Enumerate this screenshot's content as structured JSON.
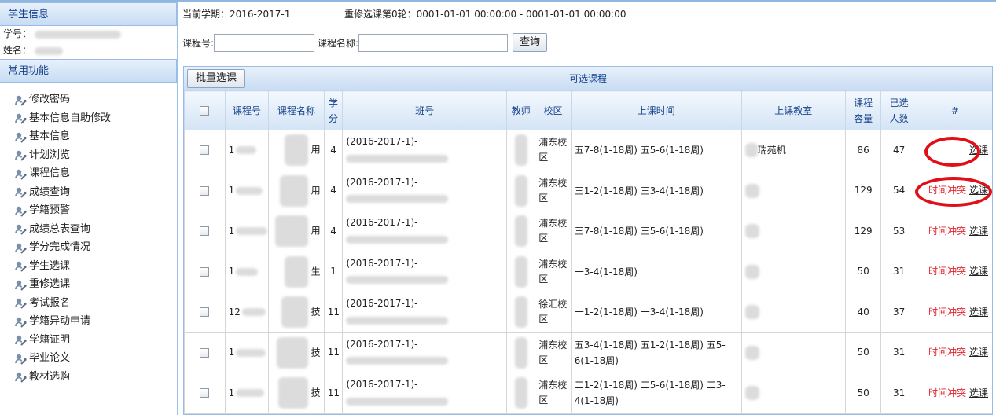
{
  "sidebar": {
    "student_title": "学生信息",
    "id_label": "学号：",
    "name_label": "姓名：",
    "functions_title": "常用功能",
    "menu": [
      "修改密码",
      "基本信息自助修改",
      "基本信息",
      "计划浏览",
      "课程信息",
      "成绩查询",
      "学籍预警",
      "成绩总表查询",
      "学分完成情况",
      "学生选课",
      "重修选课",
      "考试报名",
      "学籍异动申请",
      "学籍证明",
      "毕业论文",
      "教材选购"
    ]
  },
  "status": {
    "term": "当前学期：2016-2017-1",
    "round": "重修选课第0轮：0001-01-01 00:00:00 - 0001-01-01 00:00:00"
  },
  "search": {
    "course_no_label": "课程号:",
    "course_no_value": "",
    "course_name_label": "课程名称:",
    "course_name_value": "",
    "query_label": "查询"
  },
  "grid": {
    "batch_label": "批量选课",
    "title": "可选课程",
    "headers": [
      "课程号",
      "课程名称",
      "学分",
      "班号",
      "教师",
      "校区",
      "上课时间",
      "上课教室",
      "课程容量",
      "已选人数",
      "#"
    ],
    "rows": [
      {
        "course_no": "1",
        "name": "用",
        "credit": "4",
        "class_no": "(2016-2017-1)-",
        "campus": "浦东校区",
        "time": "五7-8(1-18周) 五5-6(1-18周)",
        "room": "瑞苑机",
        "capacity": "86",
        "enrolled": "47",
        "conflict": "",
        "action": "选课"
      },
      {
        "course_no": "1",
        "name": "用",
        "credit": "4",
        "class_no": "(2016-2017-1)-",
        "campus": "浦东校区",
        "time": "三1-2(1-18周) 三3-4(1-18周)",
        "room": "",
        "capacity": "129",
        "enrolled": "54",
        "conflict": "时间冲突",
        "action": "选课"
      },
      {
        "course_no": "1",
        "name": "用",
        "credit": "4",
        "class_no": "(2016-2017-1)-",
        "campus": "浦东校区",
        "time": "三7-8(1-18周) 三5-6(1-18周)",
        "room": "",
        "capacity": "129",
        "enrolled": "53",
        "conflict": "时间冲突",
        "action": "选课"
      },
      {
        "course_no": "1",
        "name": "生",
        "credit": "1",
        "class_no": "(2016-2017-1)-",
        "campus": "浦东校区",
        "time": "一3-4(1-18周)",
        "room": "",
        "capacity": "50",
        "enrolled": "31",
        "conflict": "时间冲突",
        "action": "选课"
      },
      {
        "course_no": "12",
        "name": "技",
        "credit": "11",
        "class_no": "(2016-2017-1)-",
        "campus": "徐汇校区",
        "time": "一1-2(1-18周) 一3-4(1-18周)",
        "room": "",
        "capacity": "40",
        "enrolled": "37",
        "conflict": "时间冲突",
        "action": "选课"
      },
      {
        "course_no": "1",
        "name": "技",
        "credit": "11",
        "class_no": "(2016-2017-1)-",
        "campus": "浦东校区",
        "time": "五3-4(1-18周) 五1-2(1-18周) 五5-6(1-18周)",
        "room": "",
        "capacity": "50",
        "enrolled": "31",
        "conflict": "时间冲突",
        "action": "选课"
      },
      {
        "course_no": "1",
        "name": "技",
        "credit": "11",
        "class_no": "(2016-2017-1)-",
        "campus": "浦东校区",
        "time": "二1-2(1-18周) 二5-6(1-18周) 二3-4(1-18周)",
        "room": "",
        "capacity": "50",
        "enrolled": "31",
        "conflict": "时间冲突",
        "action": "选课"
      }
    ]
  },
  "colors": {
    "accent": "#15428b",
    "conflict": "#e0242e",
    "annotation": "#e0101a",
    "border": "#99bbe8"
  },
  "icons": {
    "menu_item": "wrench-user-icon"
  }
}
